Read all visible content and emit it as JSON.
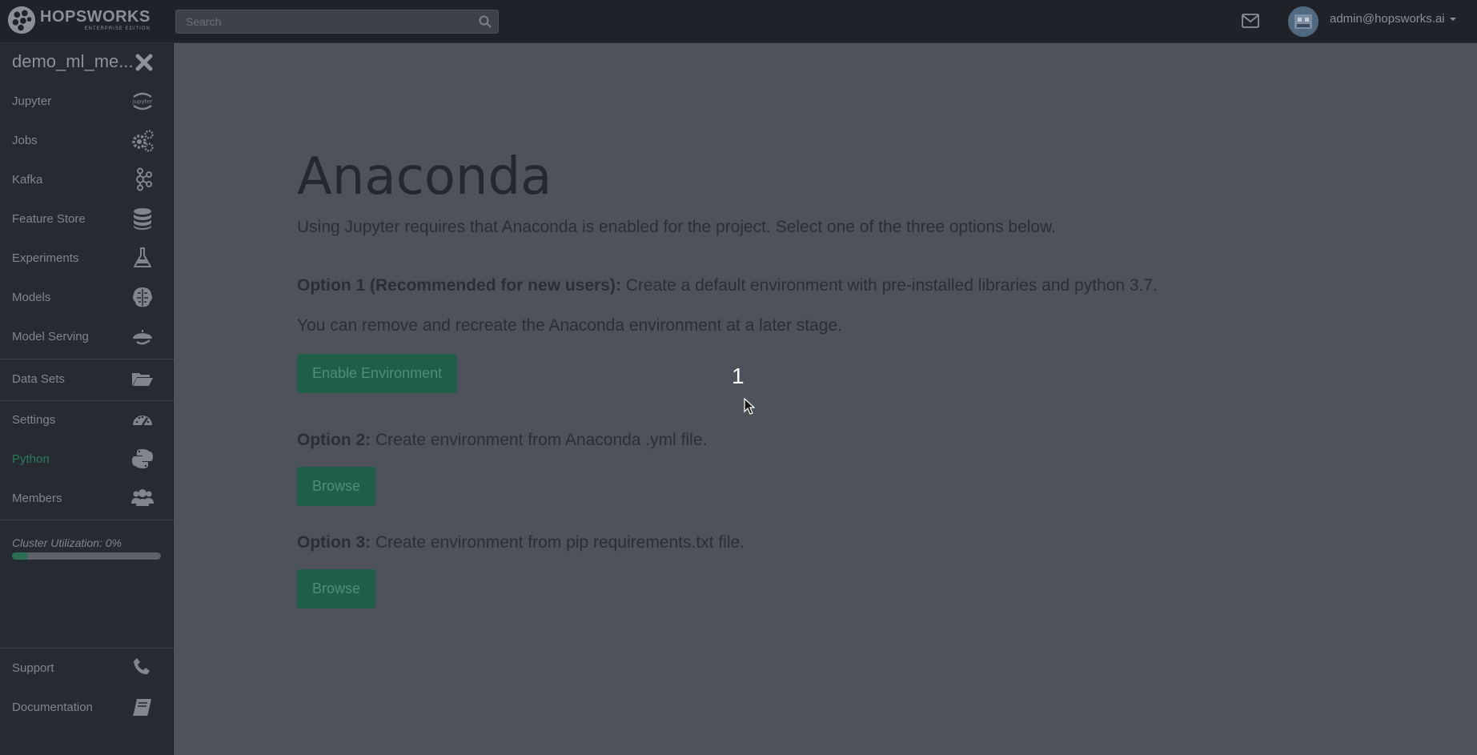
{
  "topbar": {
    "logo_name": "HOPSWORKS",
    "logo_sub": "ENTERPRISE EDITION",
    "search_placeholder": "Search",
    "user_email": "admin@hopsworks.ai"
  },
  "sidebar": {
    "project_name": "demo_ml_me...",
    "items": [
      {
        "label": "Jupyter",
        "icon": "jupyter-icon"
      },
      {
        "label": "Jobs",
        "icon": "gears-icon"
      },
      {
        "label": "Kafka",
        "icon": "kafka-icon"
      },
      {
        "label": "Feature Store",
        "icon": "database-icon"
      },
      {
        "label": "Experiments",
        "icon": "flask-icon"
      },
      {
        "label": "Models",
        "icon": "brain-icon"
      },
      {
        "label": "Model Serving",
        "icon": "serving-icon"
      },
      {
        "label": "Data Sets",
        "icon": "folder-open-icon"
      },
      {
        "label": "Settings",
        "icon": "dashboard-icon"
      },
      {
        "label": "Python",
        "icon": "python-icon",
        "active": true
      },
      {
        "label": "Members",
        "icon": "users-icon"
      },
      {
        "label": "Support",
        "icon": "phone-icon"
      },
      {
        "label": "Documentation",
        "icon": "book-icon"
      }
    ],
    "cluster_utilization_label": "Cluster Utilization: 0%",
    "cluster_utilization": 0.1
  },
  "main": {
    "title": "Anaconda",
    "intro": "Using Jupyter requires that Anaconda is enabled for the project. Select one of the three options below.",
    "option1_head": "Option 1 (Recommended for new users):",
    "option1_text": " Create a default environment with pre-installed libraries and python 3.7.",
    "option1_note": "You can remove and recreate the Anaconda environment at a later stage.",
    "enable_button": "Enable Environment",
    "option2_head": "Option 2:",
    "option2_text": " Create environment from Anaconda .yml file.",
    "browse_yml_button": "Browse",
    "option3_head": "Option 3:",
    "option3_text": " Create environment from pip requirements.txt file.",
    "browse_pip_button": "Browse"
  },
  "overlay": {
    "step_number": "1"
  },
  "colors": {
    "accent": "#1f5e49",
    "active_nav": "#2c7a5c",
    "background": "#4d525b",
    "sidebar": "#262a31"
  }
}
